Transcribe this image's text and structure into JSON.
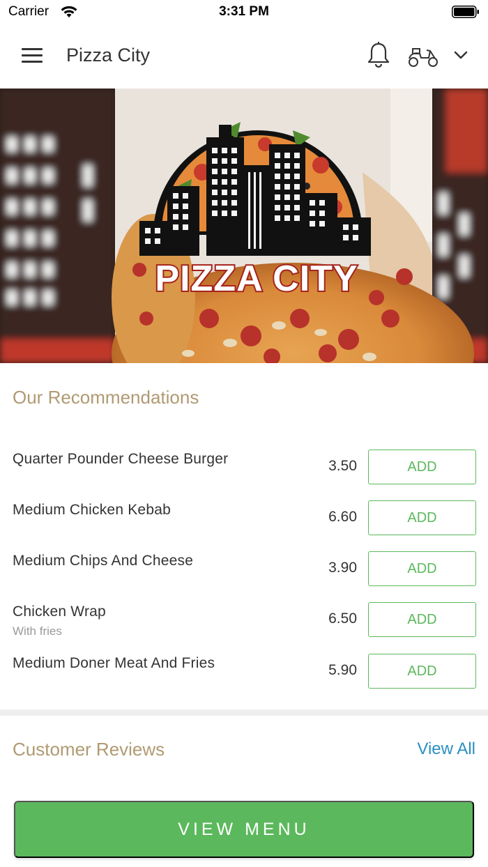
{
  "status_bar": {
    "carrier": "Carrier",
    "time": "3:31 PM"
  },
  "header": {
    "title": "Pizza City",
    "icons": [
      "menu-icon",
      "bell-icon",
      "scooter-icon",
      "chevron-down-icon"
    ]
  },
  "banner": {
    "logo_text": "PIZZA CITY"
  },
  "recommendations": {
    "title": "Our Recommendations",
    "add_label": "ADD",
    "items": [
      {
        "name": "Quarter Pounder Cheese Burger",
        "subtitle": "",
        "price": "3.50"
      },
      {
        "name": "Medium Chicken Kebab",
        "subtitle": "",
        "price": "6.60"
      },
      {
        "name": "Medium Chips And Cheese",
        "subtitle": "",
        "price": "3.90"
      },
      {
        "name": "Chicken Wrap",
        "subtitle": "With fries",
        "price": "6.50"
      },
      {
        "name": "Medium Doner Meat And Fries",
        "subtitle": "",
        "price": "5.90"
      }
    ]
  },
  "reviews": {
    "title": "Customer Reviews",
    "view_all": "View All"
  },
  "footer": {
    "view_menu": "VIEW MENU"
  },
  "colors": {
    "accent_green": "#5cb85c",
    "section_title": "#b09a72",
    "link_blue": "#2b8fc0"
  }
}
